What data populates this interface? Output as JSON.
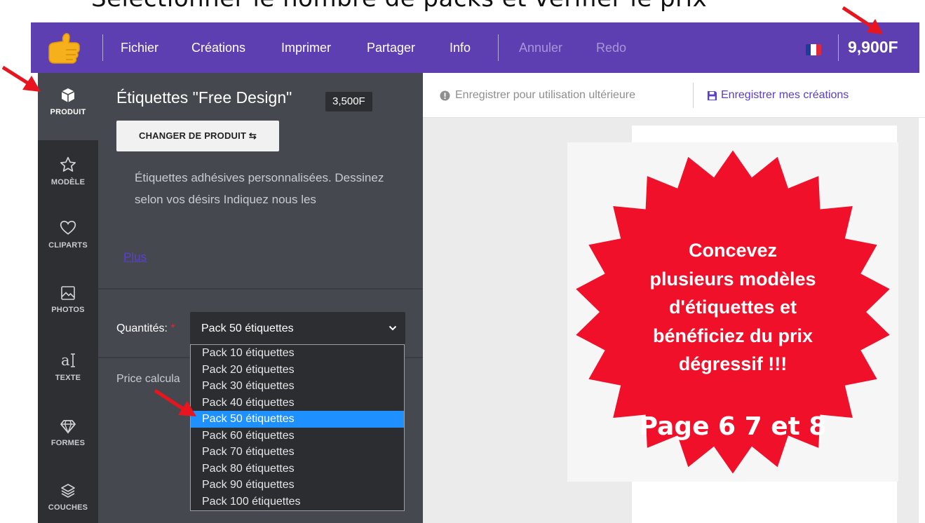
{
  "caption": "Sélectionner le nombre de packs et vérifier le prix",
  "topbar": {
    "menu": [
      "Fichier",
      "Créations",
      "Imprimer",
      "Partager",
      "Info"
    ],
    "undo": "Annuler",
    "redo": "Redo",
    "cart_total": "9,900F",
    "colors": {
      "background": "#5e3fb2",
      "disabled_text": "#a796d8"
    },
    "icons": [
      "thumbs-up-logo-icon",
      "french-flag-icon"
    ]
  },
  "sidebar": {
    "items": [
      {
        "label": "PRODUIT",
        "icon": "box-icon",
        "active": true
      },
      {
        "label": "MODÈLE",
        "icon": "star-icon"
      },
      {
        "label": "CLIPARTS",
        "icon": "heart-icon"
      },
      {
        "label": "PHOTOS",
        "icon": "image-icon"
      },
      {
        "label": "TEXTE",
        "icon": "text-icon"
      },
      {
        "label": "FORMES",
        "icon": "diamond-icon"
      },
      {
        "label": "COUCHES",
        "icon": "layers-icon"
      }
    ]
  },
  "product": {
    "title": "Étiquettes \"Free Design\"",
    "price": "3,500F",
    "change_button": "CHANGER DE PRODUIT ⇆",
    "description": "Étiquettes adhésives personnalisées. Dessinez selon vos désirs Indiquez nous les",
    "more_link": "Plus",
    "quantity_label": "Quantités:",
    "required_mark": "*",
    "quantity_selected": "Pack 50 étiquettes",
    "quantity_options": [
      "Pack 10 étiquettes",
      "Pack 20 étiquettes",
      "Pack 30 étiquettes",
      "Pack 40 étiquettes",
      "Pack 50 étiquettes",
      "Pack 60 étiquettes",
      "Pack 70 étiquettes",
      "Pack 80 étiquettes",
      "Pack 90 étiquettes",
      "Pack 100 étiquettes"
    ],
    "selected_index": 4,
    "price_calc": "Price calcula"
  },
  "canvas_toolbar": {
    "save_later": "Enregistrer pour utilisation ultérieure",
    "save_mine": "Enregistrer mes créations",
    "icons": [
      "info-circle-icon",
      "floppy-disk-icon"
    ]
  },
  "sticker": {
    "lines": [
      "Concevez",
      "plusieurs modèles",
      "d'étiquettes et",
      "bénéficiez du prix",
      "dégressif !!!"
    ],
    "page_text": "Page 6 7 et 8",
    "color": "#f0102a"
  }
}
